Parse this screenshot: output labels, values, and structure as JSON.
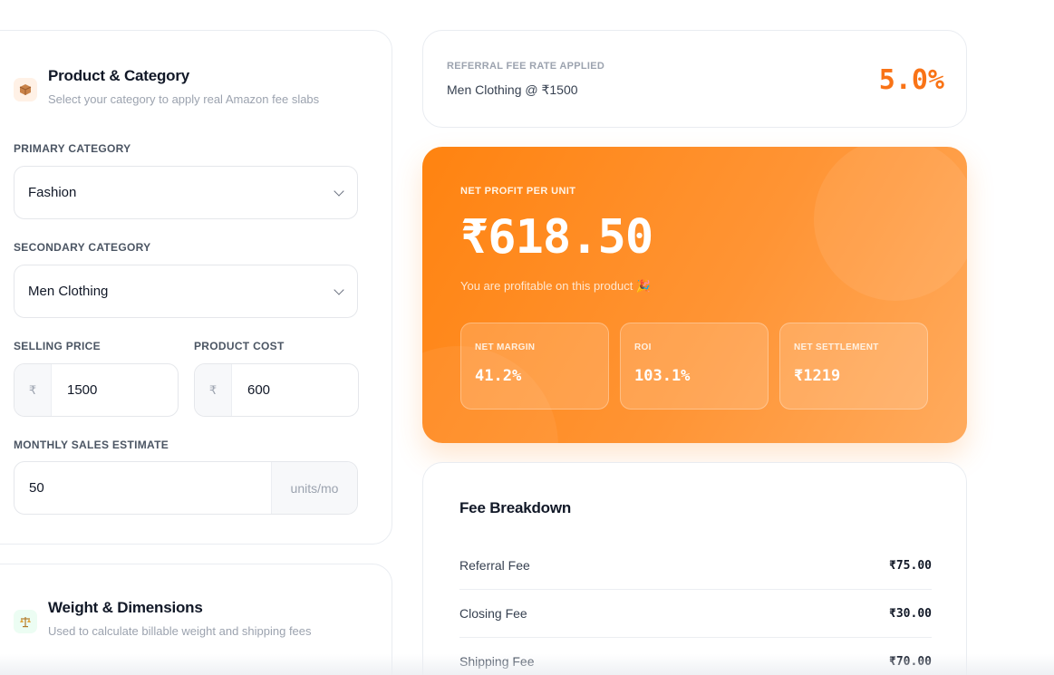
{
  "product_section": {
    "icon": "package-icon",
    "title": "Product & Category",
    "subtitle": "Select your category to apply real Amazon fee slabs"
  },
  "primary_category": {
    "label": "PRIMARY CATEGORY",
    "value": "Fashion"
  },
  "secondary_category": {
    "label": "SECONDARY CATEGORY",
    "value": "Men Clothing"
  },
  "selling_price": {
    "label": "SELLING PRICE",
    "prefix": "₹",
    "value": "1500"
  },
  "product_cost": {
    "label": "PRODUCT COST",
    "prefix": "₹",
    "value": "600"
  },
  "monthly_sales": {
    "label": "MONTHLY SALES ESTIMATE",
    "value": "50",
    "suffix": "units/mo"
  },
  "weight_section": {
    "icon": "scale-icon",
    "title": "Weight & Dimensions",
    "subtitle": "Used to calculate billable weight and shipping fees"
  },
  "referral_rate": {
    "label": "REFERRAL FEE RATE APPLIED",
    "detail": "Men Clothing @ ₹1500",
    "value": "5.0%"
  },
  "net_profit": {
    "label": "NET PROFIT PER UNIT",
    "value": "₹618.50",
    "message": "You are profitable on this product 🎉",
    "stats": [
      {
        "label": "NET MARGIN",
        "value": "41.2%"
      },
      {
        "label": "ROI",
        "value": "103.1%"
      },
      {
        "label": "NET SETTLEMENT",
        "value": "₹1219"
      }
    ]
  },
  "fee_breakdown": {
    "title": "Fee Breakdown",
    "rows": [
      {
        "name": "Referral Fee",
        "amount": "₹75.00"
      },
      {
        "name": "Closing Fee",
        "amount": "₹30.00"
      },
      {
        "name": "Shipping Fee",
        "amount": "₹70.00"
      }
    ]
  },
  "colors": {
    "accent": "#f97316",
    "profit_gradient_start": "#ff8310",
    "profit_gradient_end": "#ffab5e"
  }
}
